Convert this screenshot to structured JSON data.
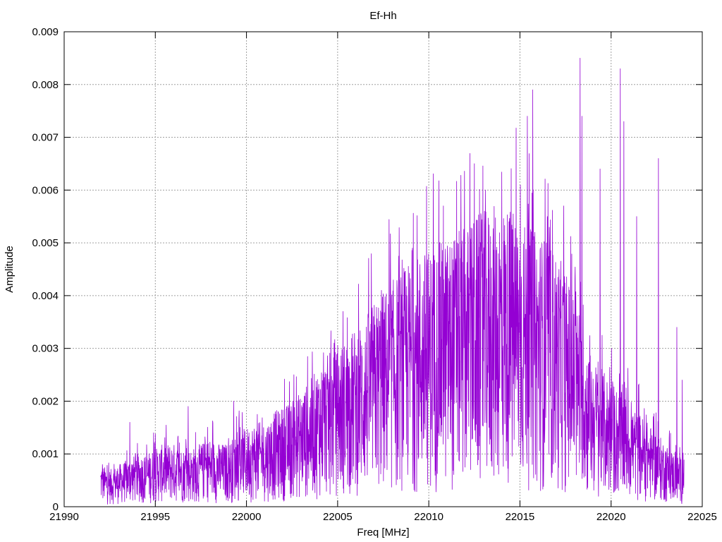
{
  "chart_data": {
    "type": "line",
    "title": "Ef-Hh",
    "xlabel": "Freq [MHz]",
    "ylabel": "Amplitude",
    "xlim": [
      21990,
      22025
    ],
    "ylim": [
      0,
      0.009
    ],
    "xticks": [
      21990,
      21995,
      22000,
      22005,
      22010,
      22015,
      22020,
      22025
    ],
    "yticks": [
      0,
      0.001,
      0.002,
      0.003,
      0.004,
      0.005,
      0.006,
      0.007,
      0.008,
      0.009
    ],
    "xtick_labels": [
      "21990",
      "21995",
      "22000",
      "22005",
      "22010",
      "22015",
      "22020",
      "22025"
    ],
    "ytick_labels": [
      "0",
      "0.001",
      "0.002",
      "0.003",
      "0.004",
      "0.005",
      "0.006",
      "0.007",
      "0.008",
      "0.009"
    ],
    "grid": true,
    "legend": "none",
    "colors": {
      "series": "#9400d3",
      "grid": "#a0a0a0",
      "axis": "#000000"
    },
    "series": [
      {
        "x_start": 21992.0,
        "x_step": 0.5,
        "y_envelope": [
          0.0008,
          0.0007,
          0.0008,
          0.0009,
          0.001,
          0.001,
          0.0011,
          0.0012,
          0.0012,
          0.0011,
          0.0011,
          0.0012,
          0.0013,
          0.0012,
          0.0012,
          0.0014,
          0.0015,
          0.0016,
          0.0016,
          0.0018,
          0.0019,
          0.002,
          0.0022,
          0.0024,
          0.0027,
          0.0029,
          0.003,
          0.0032,
          0.0034,
          0.0036,
          0.0039,
          0.0041,
          0.0043,
          0.0045,
          0.0047,
          0.0048,
          0.0049,
          0.005,
          0.0051,
          0.0052,
          0.0053,
          0.0055,
          0.0056,
          0.0057,
          0.0058,
          0.0057,
          0.0055,
          0.0053,
          0.0052,
          0.0051,
          0.0048,
          0.0045,
          0.004,
          0.0032,
          0.0028,
          0.0026,
          0.0024,
          0.0022,
          0.002,
          0.0018,
          0.0016,
          0.0014,
          0.0012,
          0.001,
          0.0009
        ],
        "peaks": [
          {
            "x": 21992.1,
            "y": 0.0008
          },
          {
            "x": 21993.6,
            "y": 0.0016
          },
          {
            "x": 21994.9,
            "y": 0.0014
          },
          {
            "x": 21996.8,
            "y": 0.0019
          },
          {
            "x": 21999.3,
            "y": 0.002
          },
          {
            "x": 22002.6,
            "y": 0.0025
          },
          {
            "x": 22004.8,
            "y": 0.0031
          },
          {
            "x": 22005.3,
            "y": 0.0037
          },
          {
            "x": 22007.4,
            "y": 0.0041
          },
          {
            "x": 22008.6,
            "y": 0.0036
          },
          {
            "x": 22009.1,
            "y": 0.0049
          },
          {
            "x": 22010.8,
            "y": 0.0057
          },
          {
            "x": 22012.5,
            "y": 0.0065
          },
          {
            "x": 22013.1,
            "y": 0.006
          },
          {
            "x": 22014.4,
            "y": 0.0054
          },
          {
            "x": 22015.4,
            "y": 0.0074
          },
          {
            "x": 22015.7,
            "y": 0.0079
          },
          {
            "x": 22016.5,
            "y": 0.0055
          },
          {
            "x": 22017.4,
            "y": 0.0057
          },
          {
            "x": 22018.3,
            "y": 0.0085
          },
          {
            "x": 22018.4,
            "y": 0.0074
          },
          {
            "x": 22019.4,
            "y": 0.0064
          },
          {
            "x": 22020.5,
            "y": 0.0083
          },
          {
            "x": 22020.7,
            "y": 0.0073
          },
          {
            "x": 22021.4,
            "y": 0.0055
          },
          {
            "x": 22022.6,
            "y": 0.0066
          },
          {
            "x": 22023.6,
            "y": 0.0034
          },
          {
            "x": 22023.9,
            "y": 0.0024
          }
        ]
      }
    ]
  }
}
